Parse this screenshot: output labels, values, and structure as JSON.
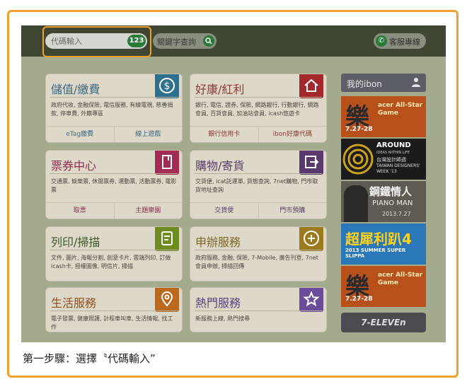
{
  "header": {
    "code_input_placeholder": "代碼輸入",
    "code_badge": "123",
    "keyword_placeholder": "關鍵字查詢",
    "service_label": "客服專線"
  },
  "cards": [
    {
      "title": "儲值/繳費",
      "desc": "政府代收, 金融保險, 電信服務, 有線電視, 慈善捐款, 停車費, 外籍專區",
      "links": [
        "eTag繳費",
        "線上遊戲"
      ],
      "icon": "dollar-icon"
    },
    {
      "title": "好康/紅利",
      "desc": "銀行, 電信, 證券, 保險, 網路銀行, 行動銀行, 網路會員, 百貨會員, 加油站會員, icash悠遊卡",
      "links": [
        "銀行信用卡",
        "ibon好康代碼"
      ],
      "icon": "home-icon"
    },
    {
      "title": "票券中心",
      "desc": "交通票, 娛樂票, 休閒票券, 運動票, 活動票券, 電影票",
      "links": [
        "取票",
        "主題樂園"
      ],
      "icon": "ticket-icon"
    },
    {
      "title": "購物/寄貨",
      "desc": "交貨便, icat託運單, 貨態查詢, 7net購物, 門市取貨地址查詢",
      "links": [
        "交貨便",
        "門市預購"
      ],
      "icon": "exit-icon"
    },
    {
      "title": "列印/掃描",
      "desc": "文件, 圖片, 海報分割, 創意卡片, 雲端列印, 訂做icash卡, 授權圖像, 明信片, 掃描",
      "links": [],
      "icon": "document-icon"
    },
    {
      "title": "申辦服務",
      "desc": "政府服務, 金融, 保險, 7-Mobile, 廣告刊登, 7net會員申辦, 掃描回傳",
      "links": [],
      "icon": "plus-icon"
    },
    {
      "title": "生活服務",
      "desc": "電子發票, 健康照護, 計程車叫車, 生活情報, 找工作",
      "links": [],
      "icon": "location-icon"
    },
    {
      "title": "熱門服務",
      "desc": "新服務上線, 熱門搜尋",
      "links": [],
      "icon": "star-icon"
    }
  ],
  "sidebar": {
    "title": "我的ibon",
    "brand": "7-ELEVEn",
    "ads": [
      {
        "big": "樂",
        "small": "acer All-Star Game",
        "date": "7.27-28"
      },
      {
        "line1": "AROUND",
        "line2": "IDEAS WITHIN LIFE",
        "line3": "台灣設計師週",
        "line4": "TAIWAN DESIGNERS' WEEK '13"
      },
      {
        "line1": "鋼鐵情人",
        "line2": "PIANO MAN",
        "line3": "2013.7.27"
      },
      {
        "line1": "超犀利趴4",
        "line2": "2013 SUMMER SUPER SLIPPA"
      },
      {
        "big": "樂",
        "small": "acer All-Star Game",
        "date": "7.27-28"
      }
    ]
  },
  "caption": "第一步驟：選擇〝代碼輸入”",
  "colors": {
    "highlight": "#f0a02c",
    "accent_green": "#2a7a3a",
    "card_icons": [
      "#2e6f8e",
      "#a3282b",
      "#a12d55",
      "#5a3a6e",
      "#6f8a1e",
      "#9a7a1c",
      "#b96a1e",
      "#6a4e9a"
    ]
  }
}
